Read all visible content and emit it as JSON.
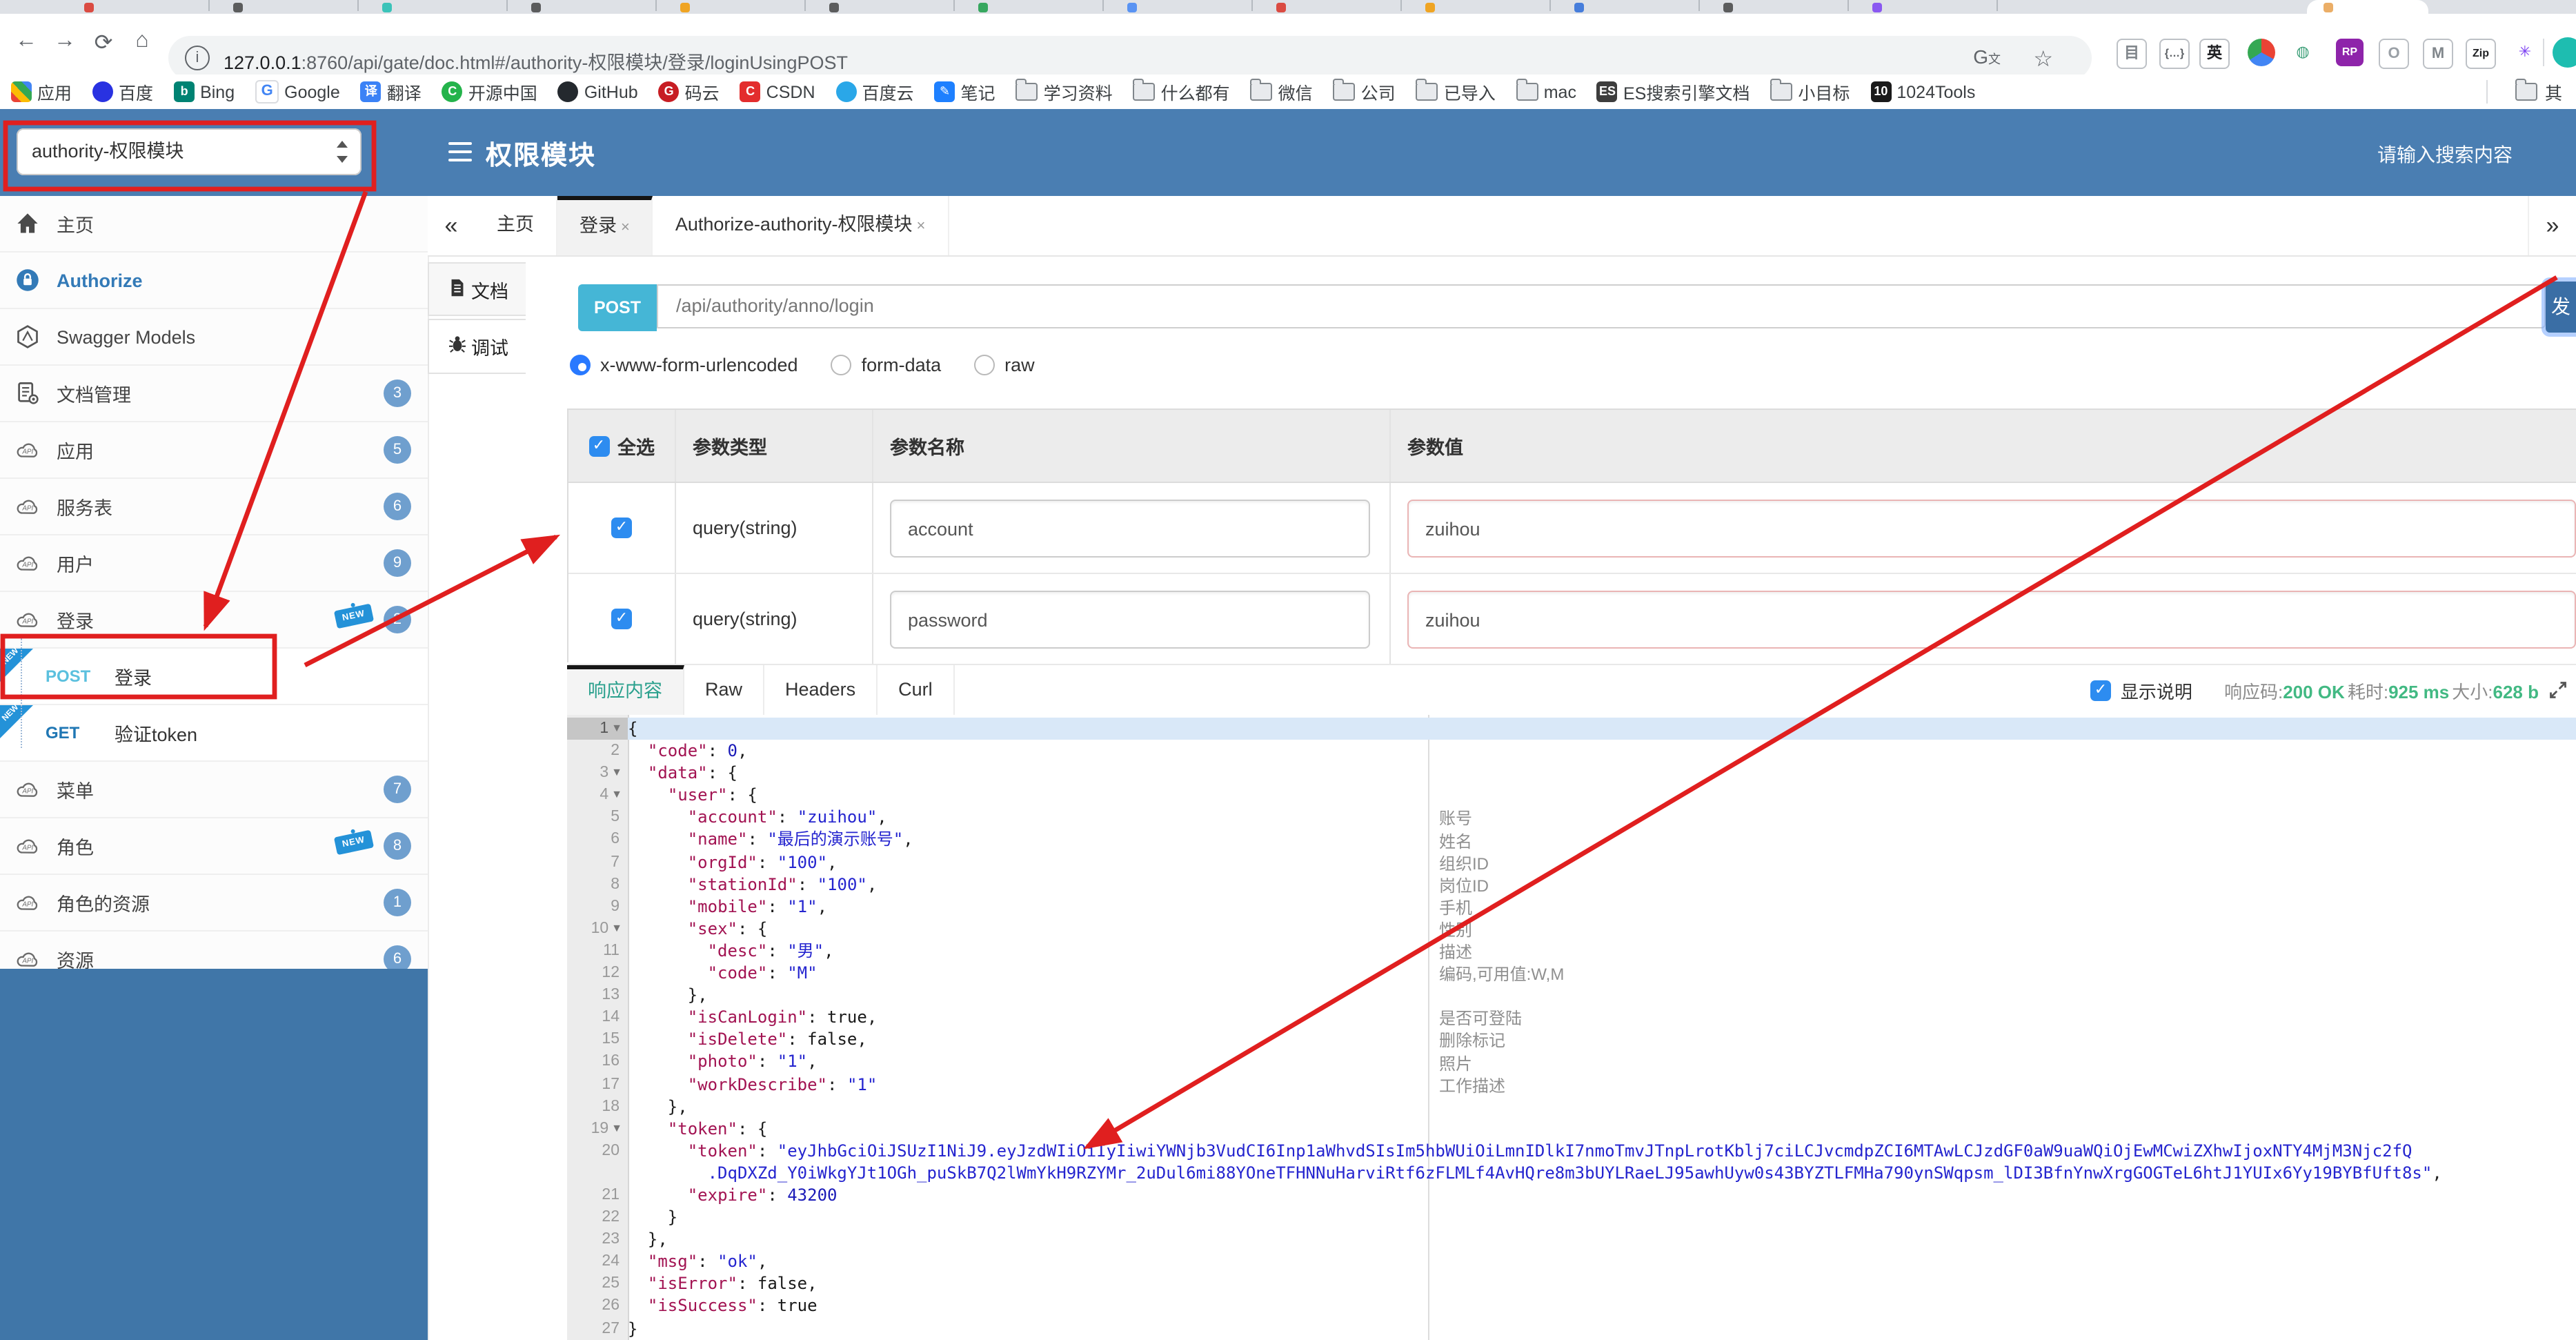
{
  "browser": {
    "url_host": "127.0.0.1",
    "url_rest": ":8760/api/gate/doc.html#/authority-权限模块/登录/loginUsingPOST",
    "bookmarks": [
      {
        "label": "应用",
        "icon": "grid"
      },
      {
        "label": "百度",
        "icon": "circle",
        "color": "#2932e1",
        "letter": ""
      },
      {
        "label": "Bing",
        "icon": "square",
        "color": "#008373",
        "letter": "b"
      },
      {
        "label": "Google",
        "icon": "g",
        "color": "#4285f4",
        "letter": "G"
      },
      {
        "label": "翻译",
        "icon": "square",
        "color": "#3b82f6",
        "letter": "译"
      },
      {
        "label": "开源中国",
        "icon": "circle",
        "color": "#24b34b",
        "letter": "C"
      },
      {
        "label": "GitHub",
        "icon": "circle",
        "color": "#24292e",
        "letter": ""
      },
      {
        "label": "码云",
        "icon": "circle",
        "color": "#c71d23",
        "letter": "G"
      },
      {
        "label": "CSDN",
        "icon": "square",
        "color": "#e32d2d",
        "letter": "C"
      },
      {
        "label": "百度云",
        "icon": "circle",
        "color": "#2aa7e8",
        "letter": ""
      },
      {
        "label": "笔记",
        "icon": "square",
        "color": "#1e80ff",
        "letter": "✎"
      },
      {
        "label": "学习资料",
        "icon": "folder"
      },
      {
        "label": "什么都有",
        "icon": "folder"
      },
      {
        "label": "微信",
        "icon": "folder"
      },
      {
        "label": "公司",
        "icon": "folder"
      },
      {
        "label": "已导入",
        "icon": "folder"
      },
      {
        "label": "mac",
        "icon": "folder"
      },
      {
        "label": "ES搜索引擎文档",
        "icon": "square",
        "color": "#3d3d3d",
        "letter": "ES"
      },
      {
        "label": "小目标",
        "icon": "folder"
      },
      {
        "label": "1024Tools",
        "icon": "square",
        "color": "#1a1a1a",
        "letter": "10"
      }
    ],
    "other_bookmarks": "其",
    "extensions": [
      "page-icon",
      "braces-icon",
      "translate-en-icon",
      "chrome-icon",
      "globe-icon",
      "rp-icon",
      "o-icon",
      "m-icon",
      "gitzip-icon",
      "asterisk-icon"
    ]
  },
  "header": {
    "module_select": "authority-权限模块",
    "title": "权限模块",
    "search_placeholder": "请输入搜索内容"
  },
  "sidebar": {
    "items": [
      {
        "type": "item",
        "label": "主页",
        "icon": "home"
      },
      {
        "type": "item",
        "label": "Authorize",
        "icon": "lock",
        "accent": true
      },
      {
        "type": "item",
        "label": "Swagger Models",
        "icon": "hexagon"
      },
      {
        "type": "item",
        "label": "文档管理",
        "icon": "docgear",
        "badge": "3"
      },
      {
        "type": "item",
        "label": "应用",
        "icon": "cloud",
        "badge": "5"
      },
      {
        "type": "item",
        "label": "服务表",
        "icon": "cloud",
        "badge": "6"
      },
      {
        "type": "item",
        "label": "用户",
        "icon": "cloud",
        "badge": "9"
      },
      {
        "type": "item",
        "label": "登录",
        "icon": "cloud",
        "badge": "2",
        "isNew": true
      },
      {
        "type": "sub",
        "method": "POST",
        "label": "登录",
        "isNew": true
      },
      {
        "type": "sub",
        "method": "GET",
        "label": "验证token",
        "isNew": true
      },
      {
        "type": "item",
        "label": "菜单",
        "icon": "cloud",
        "badge": "7"
      },
      {
        "type": "item",
        "label": "角色",
        "icon": "cloud",
        "badge": "8",
        "isNew": true
      },
      {
        "type": "item",
        "label": "角色的资源",
        "icon": "cloud",
        "badge": "1"
      },
      {
        "type": "item",
        "label": "资源",
        "icon": "cloud",
        "badge": "6"
      }
    ]
  },
  "main": {
    "tabs": [
      {
        "label": "主页",
        "closable": false,
        "active": false
      },
      {
        "label": "登录",
        "closable": true,
        "active": true
      },
      {
        "label": "Authorize-authority-权限模块",
        "closable": true,
        "active": false
      }
    ],
    "vtabs": [
      {
        "label": "文档",
        "icon": "doc",
        "active": false
      },
      {
        "label": "调试",
        "icon": "bug",
        "active": true
      }
    ]
  },
  "endpoint": {
    "method": "POST",
    "path": "/api/authority/anno/login",
    "send_label": "发",
    "body_types": [
      {
        "label": "x-www-form-urlencoded",
        "selected": true
      },
      {
        "label": "form-data",
        "selected": false
      },
      {
        "label": "raw",
        "selected": false
      }
    ]
  },
  "params": {
    "headers": {
      "select": "全选",
      "type": "参数类型",
      "name": "参数名称",
      "value": "参数值"
    },
    "rows": [
      {
        "checked": true,
        "type": "query(string)",
        "name": "account",
        "value": "zuihou"
      },
      {
        "checked": true,
        "type": "query(string)",
        "name": "password",
        "value": "zuihou"
      }
    ]
  },
  "response": {
    "tabs": [
      {
        "label": "响应内容",
        "active": true
      },
      {
        "label": "Raw",
        "active": false
      },
      {
        "label": "Headers",
        "active": false
      },
      {
        "label": "Curl",
        "active": false
      }
    ],
    "show_desc_label": "显示说明",
    "meta": [
      {
        "k": "响应码:",
        "v": "200 OK"
      },
      {
        "k": "耗时:",
        "v": "925 ms"
      },
      {
        "k": "大小:",
        "v": "628 b"
      }
    ]
  },
  "code": {
    "lines": [
      {
        "n": 1,
        "fold": true,
        "sel": true,
        "segs": [
          [
            "p",
            "{"
          ]
        ]
      },
      {
        "n": 2,
        "segs": [
          [
            "p",
            "  "
          ],
          [
            "k",
            "\"code\""
          ],
          [
            "p",
            ": "
          ],
          [
            "n",
            "0"
          ],
          [
            "p",
            ","
          ]
        ]
      },
      {
        "n": 3,
        "fold": true,
        "segs": [
          [
            "p",
            "  "
          ],
          [
            "k",
            "\"data\""
          ],
          [
            "p",
            ": {"
          ]
        ]
      },
      {
        "n": 4,
        "fold": true,
        "segs": [
          [
            "p",
            "    "
          ],
          [
            "k",
            "\"user\""
          ],
          [
            "p",
            ": {"
          ]
        ]
      },
      {
        "n": 5,
        "note": "账号",
        "segs": [
          [
            "p",
            "      "
          ],
          [
            "k",
            "\"account\""
          ],
          [
            "p",
            ": "
          ],
          [
            "s",
            "\"zuihou\""
          ],
          [
            "p",
            ","
          ]
        ]
      },
      {
        "n": 6,
        "note": "姓名",
        "segs": [
          [
            "p",
            "      "
          ],
          [
            "k",
            "\"name\""
          ],
          [
            "p",
            ": "
          ],
          [
            "s",
            "\"最后的演示账号\""
          ],
          [
            "p",
            ","
          ]
        ]
      },
      {
        "n": 7,
        "note": "组织ID",
        "segs": [
          [
            "p",
            "      "
          ],
          [
            "k",
            "\"orgId\""
          ],
          [
            "p",
            ": "
          ],
          [
            "s",
            "\"100\""
          ],
          [
            "p",
            ","
          ]
        ]
      },
      {
        "n": 8,
        "note": "岗位ID",
        "segs": [
          [
            "p",
            "      "
          ],
          [
            "k",
            "\"stationId\""
          ],
          [
            "p",
            ": "
          ],
          [
            "s",
            "\"100\""
          ],
          [
            "p",
            ","
          ]
        ]
      },
      {
        "n": 9,
        "note": "手机",
        "segs": [
          [
            "p",
            "      "
          ],
          [
            "k",
            "\"mobile\""
          ],
          [
            "p",
            ": "
          ],
          [
            "s",
            "\"1\""
          ],
          [
            "p",
            ","
          ]
        ]
      },
      {
        "n": 10,
        "fold": true,
        "note": "性别",
        "segs": [
          [
            "p",
            "      "
          ],
          [
            "k",
            "\"sex\""
          ],
          [
            "p",
            ": {"
          ]
        ]
      },
      {
        "n": 11,
        "note": "描述",
        "segs": [
          [
            "p",
            "        "
          ],
          [
            "k",
            "\"desc\""
          ],
          [
            "p",
            ": "
          ],
          [
            "s",
            "\"男\""
          ],
          [
            "p",
            ","
          ]
        ]
      },
      {
        "n": 12,
        "note": "编码,可用值:W,M",
        "segs": [
          [
            "p",
            "        "
          ],
          [
            "k",
            "\"code\""
          ],
          [
            "p",
            ": "
          ],
          [
            "s",
            "\"M\""
          ]
        ]
      },
      {
        "n": 13,
        "segs": [
          [
            "p",
            "      },"
          ]
        ]
      },
      {
        "n": 14,
        "note": "是否可登陆",
        "segs": [
          [
            "p",
            "      "
          ],
          [
            "k",
            "\"isCanLogin\""
          ],
          [
            "p",
            ": "
          ],
          [
            "b",
            "true"
          ],
          [
            "p",
            ","
          ]
        ]
      },
      {
        "n": 15,
        "note": "删除标记",
        "segs": [
          [
            "p",
            "      "
          ],
          [
            "k",
            "\"isDelete\""
          ],
          [
            "p",
            ": "
          ],
          [
            "b",
            "false"
          ],
          [
            "p",
            ","
          ]
        ]
      },
      {
        "n": 16,
        "note": "照片",
        "segs": [
          [
            "p",
            "      "
          ],
          [
            "k",
            "\"photo\""
          ],
          [
            "p",
            ": "
          ],
          [
            "s",
            "\"1\""
          ],
          [
            "p",
            ","
          ]
        ]
      },
      {
        "n": 17,
        "note": "工作描述",
        "segs": [
          [
            "p",
            "      "
          ],
          [
            "k",
            "\"workDescribe\""
          ],
          [
            "p",
            ": "
          ],
          [
            "s",
            "\"1\""
          ]
        ]
      },
      {
        "n": 18,
        "segs": [
          [
            "p",
            "    },"
          ]
        ]
      },
      {
        "n": 19,
        "fold": true,
        "segs": [
          [
            "p",
            "    "
          ],
          [
            "k",
            "\"token\""
          ],
          [
            "p",
            ": {"
          ]
        ]
      },
      {
        "n": 20,
        "segs": [
          [
            "p",
            "      "
          ],
          [
            "k",
            "\"token\""
          ],
          [
            "p",
            ": "
          ],
          [
            "s",
            "\"eyJhbGciOiJSUzI1NiJ9.eyJzdWIiOiIyIiwiYWNjb3VudCI6Inp1aWhvdSIsIm5hbWUiOiLmnIDlkI7nmoTmvJTnpLrotKblj7ciLCJvcmdpZCI6MTAwLCJzdGF0aW9uaWQiOjEwMCwiZXhwIjoxNTY4MjM3Njc2fQ"
          ]
        ],
        "cont": [
          [
            "p",
            "        "
          ],
          [
            "s",
            ".DqDXZd_Y0iWkgYJt1OGh_puSkB7Q2lWmYkH9RZYMr_2uDul6mi88YOneTFHNNuHarviRtf6zFLMLf4AvHQre8m3bUYLRaeLJ95awhUyw0s43BYZTLFMHa790ynSWqpsm_lDI3BfnYnwXrgGOGTeL6htJ1YUIx6Yy19BYBfUft8s\""
          ],
          [
            "p",
            ","
          ]
        ]
      },
      {
        "n": 21,
        "segs": [
          [
            "p",
            "      "
          ],
          [
            "k",
            "\"expire\""
          ],
          [
            "p",
            ": "
          ],
          [
            "n",
            "43200"
          ]
        ]
      },
      {
        "n": 22,
        "segs": [
          [
            "p",
            "    }"
          ]
        ]
      },
      {
        "n": 23,
        "segs": [
          [
            "p",
            "  },"
          ]
        ]
      },
      {
        "n": 24,
        "segs": [
          [
            "p",
            "  "
          ],
          [
            "k",
            "\"msg\""
          ],
          [
            "p",
            ": "
          ],
          [
            "s",
            "\"ok\""
          ],
          [
            "p",
            ","
          ]
        ]
      },
      {
        "n": 25,
        "segs": [
          [
            "p",
            "  "
          ],
          [
            "k",
            "\"isError\""
          ],
          [
            "p",
            ": "
          ],
          [
            "b",
            "false"
          ],
          [
            "p",
            ","
          ]
        ]
      },
      {
        "n": 26,
        "segs": [
          [
            "p",
            "  "
          ],
          [
            "k",
            "\"isSuccess\""
          ],
          [
            "p",
            ": "
          ],
          [
            "b",
            "true"
          ]
        ]
      },
      {
        "n": 27,
        "segs": [
          [
            "p",
            "}"
          ]
        ]
      }
    ]
  },
  "colors": {
    "accent_blue": "#4a7eb2",
    "annotation_red": "#e01f1f",
    "post_chip": "#45b6d6",
    "success_green": "#42b983"
  }
}
